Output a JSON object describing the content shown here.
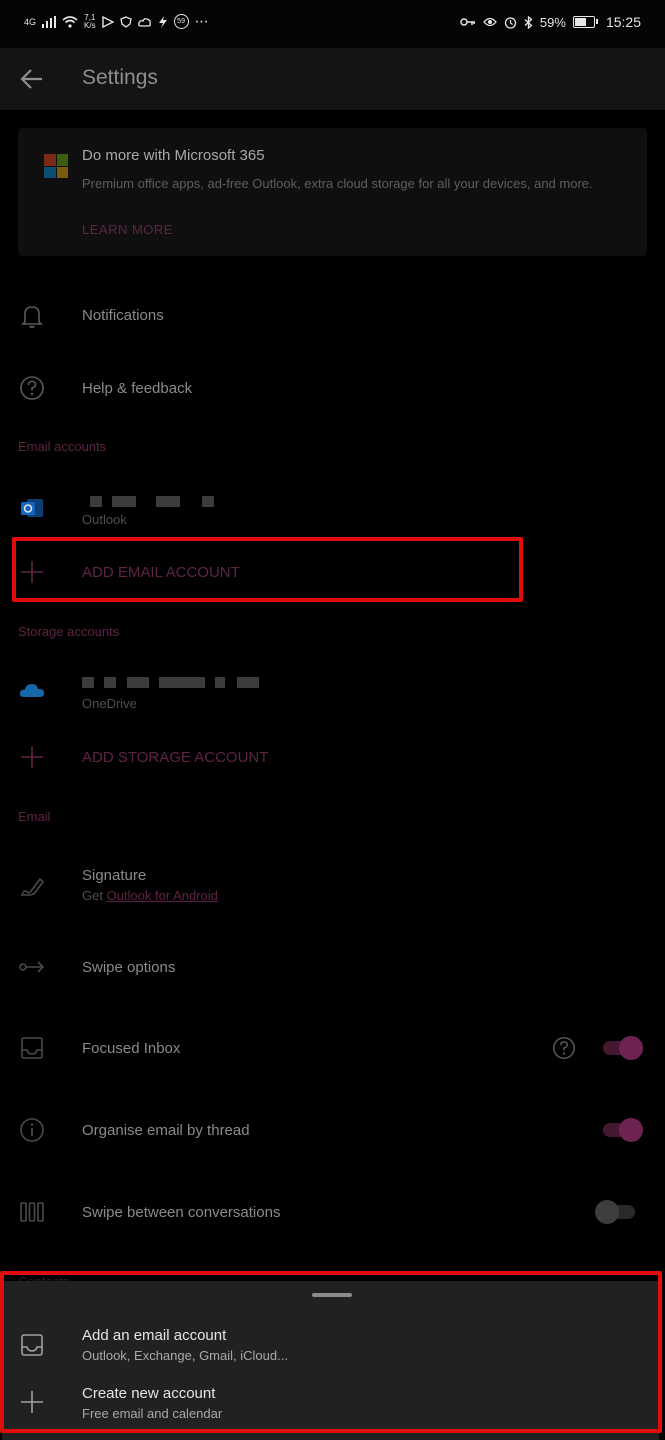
{
  "status_bar": {
    "network": "4G",
    "speed_value": "7,1",
    "speed_unit": "K/s",
    "notification_badge": "59",
    "battery_percent": "59%",
    "time": "15:25"
  },
  "app_bar": {
    "title": "Settings",
    "back_icon": "back-arrow-icon"
  },
  "promo": {
    "title": "Do more with Microsoft 365",
    "body": "Premium office apps, ad-free Outlook, extra cloud storage for all your devices, and more.",
    "link": "LEARN MORE",
    "logo_colors": [
      "#f25022",
      "#7fba00",
      "#00a4ef",
      "#ffb900"
    ]
  },
  "menu": {
    "notifications": "Notifications",
    "help": "Help & feedback"
  },
  "email_accounts": {
    "header": "Email accounts",
    "account_provider": "Outlook",
    "add_label": "ADD EMAIL ACCOUNT"
  },
  "storage_accounts": {
    "header": "Storage accounts",
    "account_provider": "OneDrive",
    "add_label": "ADD STORAGE ACCOUNT"
  },
  "email": {
    "header": "Email",
    "signature_label": "Signature",
    "signature_sub_prefix": "Get",
    "signature_sub_link": "Outlook for Android",
    "swipe_options": "Swipe options",
    "focused_inbox": "Focused Inbox",
    "focused_inbox_on": true,
    "organise_thread": "Organise email by thread",
    "organise_thread_on": true,
    "swipe_conversations": "Swipe between conversations",
    "swipe_conversations_on": false
  },
  "contacts_header": "Contacts",
  "bottom_sheet": {
    "add_email_title": "Add an email account",
    "add_email_sub": "Outlook, Exchange, Gmail, iCloud...",
    "create_title": "Create new account",
    "create_sub": "Free email and calendar"
  },
  "colors": {
    "accent": "#5f2444",
    "highlight": "#e10d0d",
    "background": "#000000",
    "sheet": "#212121"
  }
}
